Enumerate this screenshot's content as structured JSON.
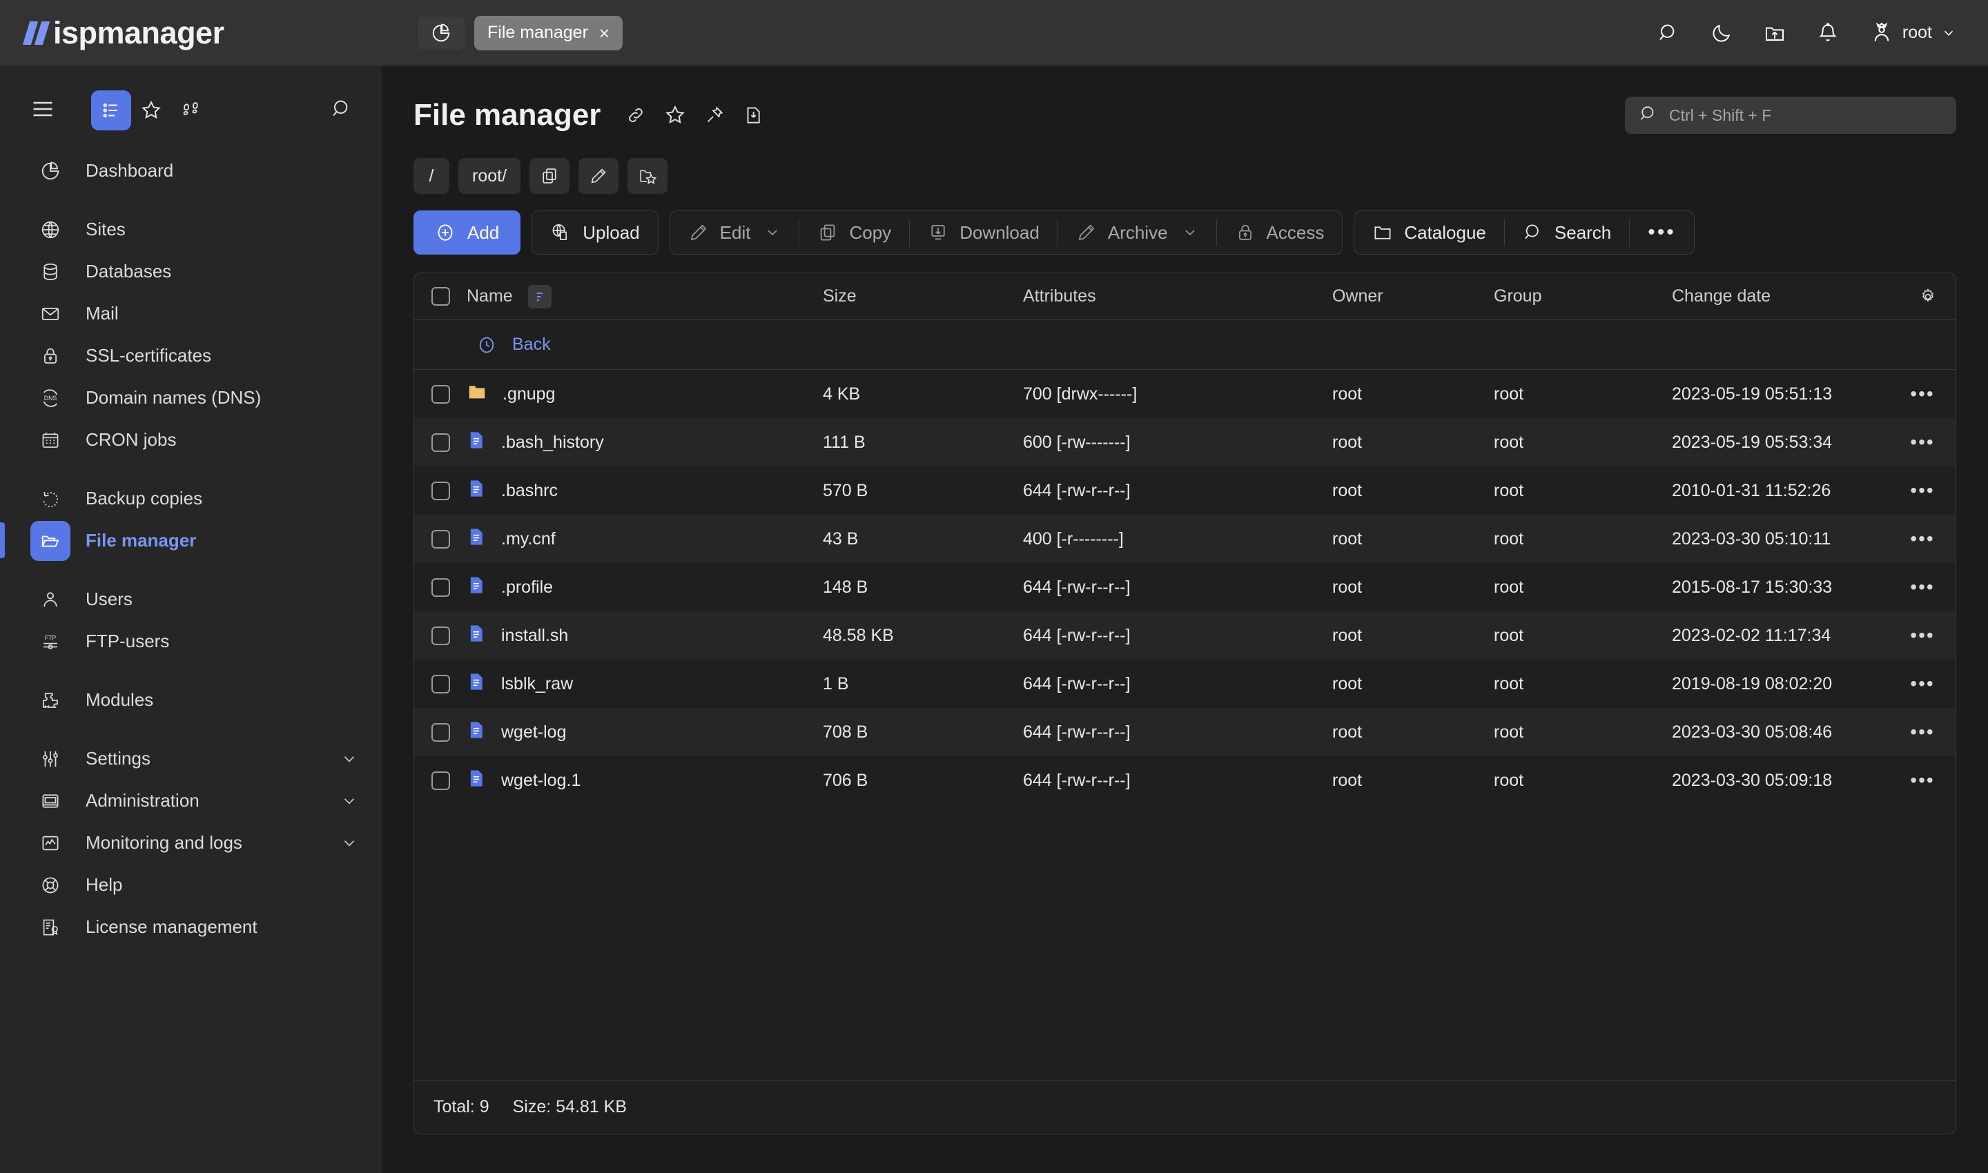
{
  "brand": {
    "name": "ispmanager"
  },
  "topbar": {
    "tab_history_icon": "pie-chart-icon",
    "tabs": [
      {
        "label": "File manager",
        "close": "×",
        "active": true
      }
    ],
    "actions": [
      {
        "name": "search-icon"
      },
      {
        "name": "dark-mode-icon"
      },
      {
        "name": "upload-folder-icon"
      },
      {
        "name": "notifications-icon"
      }
    ],
    "user": {
      "label": "root",
      "chevron": "⌄"
    }
  },
  "sidebar": {
    "tools": [
      {
        "name": "hamburger-menu-icon"
      },
      {
        "name": "list-view-icon",
        "active": true
      },
      {
        "name": "favourites-star-icon"
      },
      {
        "name": "footsteps-icon"
      },
      {
        "name": "sidebar-search-icon"
      }
    ],
    "items": [
      {
        "label": "Dashboard",
        "icon": "pie-chart-icon"
      },
      {
        "label": "Sites",
        "icon": "globe-icon",
        "gap": true
      },
      {
        "label": "Databases",
        "icon": "database-icon"
      },
      {
        "label": "Mail",
        "icon": "envelope-icon"
      },
      {
        "label": "SSL-certificates",
        "icon": "lock-icon"
      },
      {
        "label": "Domain names (DNS)",
        "icon": "dns-icon"
      },
      {
        "label": "CRON jobs",
        "icon": "calendar-icon"
      },
      {
        "label": "Backup copies",
        "icon": "restore-icon",
        "gap": true
      },
      {
        "label": "File manager",
        "icon": "folder-open-icon",
        "active": true
      },
      {
        "label": "Users",
        "icon": "user-icon",
        "gap": true
      },
      {
        "label": "FTP-users",
        "icon": "ftp-icon"
      },
      {
        "label": "Modules",
        "icon": "puzzle-icon",
        "gap": true
      },
      {
        "label": "Settings",
        "icon": "sliders-icon",
        "gap": true,
        "chevron": true
      },
      {
        "label": "Administration",
        "icon": "monitor-icon",
        "chevron": true
      },
      {
        "label": "Monitoring and logs",
        "icon": "graph-icon",
        "chevron": true
      },
      {
        "label": "Help",
        "icon": "lifebuoy-icon"
      },
      {
        "label": "License management",
        "icon": "license-icon"
      }
    ]
  },
  "page": {
    "title": "File manager",
    "title_icons": [
      {
        "name": "link-icon"
      },
      {
        "name": "favourite-star-icon"
      },
      {
        "name": "pin-icon"
      },
      {
        "name": "export-icon"
      }
    ],
    "search": {
      "placeholder": "Ctrl + Shift + F",
      "value": ""
    },
    "breadcrumbs": [
      {
        "label": "/",
        "type": "text"
      },
      {
        "label": "root/",
        "type": "text"
      },
      {
        "label": "",
        "type": "icon",
        "icon": "copy-path-icon"
      },
      {
        "label": "",
        "type": "icon",
        "icon": "edit-path-icon"
      },
      {
        "label": "",
        "type": "icon",
        "icon": "bookmark-folder-icon"
      }
    ]
  },
  "toolbar": {
    "add": "Add",
    "upload": "Upload",
    "edit": "Edit",
    "copy": "Copy",
    "download": "Download",
    "archive": "Archive",
    "access": "Access",
    "catalogue": "Catalogue",
    "search": "Search",
    "more": "•••"
  },
  "table": {
    "columns": [
      "Name",
      "Size",
      "Attributes",
      "Owner",
      "Group",
      "Change date"
    ],
    "back_label": "Back",
    "settings_icon": "table-settings-gear-icon",
    "rows": [
      {
        "icon": "folder-icon",
        "name": ".gnupg",
        "size": "4 KB",
        "attributes": "700 [drwx------]",
        "owner": "root",
        "group": "root",
        "date": "2023-05-19 05:51:13"
      },
      {
        "icon": "file-icon",
        "name": ".bash_history",
        "size": "111 B",
        "attributes": "600 [-rw-------]",
        "owner": "root",
        "group": "root",
        "date": "2023-05-19 05:53:34"
      },
      {
        "icon": "file-icon",
        "name": ".bashrc",
        "size": "570 B",
        "attributes": "644 [-rw-r--r--]",
        "owner": "root",
        "group": "root",
        "date": "2010-01-31 11:52:26"
      },
      {
        "icon": "file-icon",
        "name": ".my.cnf",
        "size": "43 B",
        "attributes": "400 [-r--------]",
        "owner": "root",
        "group": "root",
        "date": "2023-03-30 05:10:11"
      },
      {
        "icon": "file-icon",
        "name": ".profile",
        "size": "148 B",
        "attributes": "644 [-rw-r--r--]",
        "owner": "root",
        "group": "root",
        "date": "2015-08-17 15:30:33"
      },
      {
        "icon": "file-icon",
        "name": "install.sh",
        "size": "48.58 KB",
        "attributes": "644 [-rw-r--r--]",
        "owner": "root",
        "group": "root",
        "date": "2023-02-02 11:17:34"
      },
      {
        "icon": "file-icon",
        "name": "lsblk_raw",
        "size": "1 B",
        "attributes": "644 [-rw-r--r--]",
        "owner": "root",
        "group": "root",
        "date": "2019-08-19 08:02:20"
      },
      {
        "icon": "file-icon",
        "name": "wget-log",
        "size": "708 B",
        "attributes": "644 [-rw-r--r--]",
        "owner": "root",
        "group": "root",
        "date": "2023-03-30 05:08:46"
      },
      {
        "icon": "file-icon",
        "name": "wget-log.1",
        "size": "706 B",
        "attributes": "644 [-rw-r--r--]",
        "owner": "root",
        "group": "root",
        "date": "2023-03-30 05:09:18"
      }
    ],
    "row_menu": "•••"
  },
  "footer": {
    "total": "Total: 9",
    "size": "Size: 54.81 KB"
  },
  "colors": {
    "accent": "#5777e6",
    "accent_text": "#7b94f0",
    "folder": "#f0c070",
    "file": "#5777e6",
    "topbar_bg": "#333333",
    "sidebar_bg": "#262626",
    "main_bg": "#1b1b1b"
  }
}
